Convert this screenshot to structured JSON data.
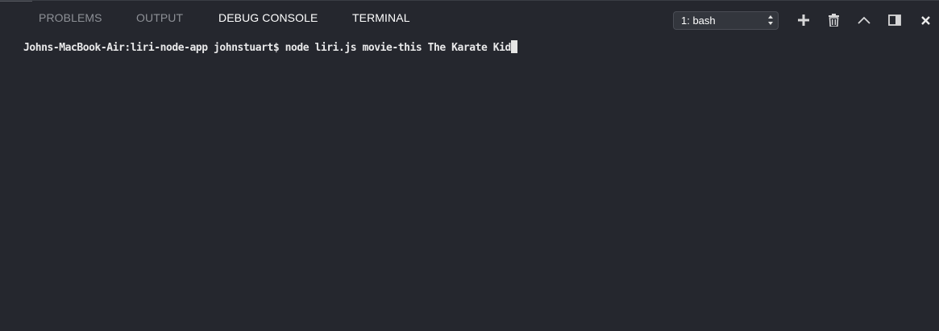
{
  "tabs": {
    "problems": "PROBLEMS",
    "output": "OUTPUT",
    "debug_console": "DEBUG CONSOLE",
    "terminal": "TERMINAL"
  },
  "terminal_select": {
    "value": "1: bash"
  },
  "actions": {
    "add_icon": "plus-icon",
    "delete_icon": "trash-icon",
    "maximize_icon": "chevron-up-icon",
    "split_icon": "split-panel-icon",
    "close_icon": "close-icon"
  },
  "terminal": {
    "line": "Johns-MacBook-Air:liri-node-app johnstuart$ node liri.js movie-this The Karate Kid"
  },
  "colors": {
    "background": "#25272e",
    "tab_inactive": "#8d9096",
    "tab_active": "#ffffff",
    "text": "#e9e9ea"
  }
}
